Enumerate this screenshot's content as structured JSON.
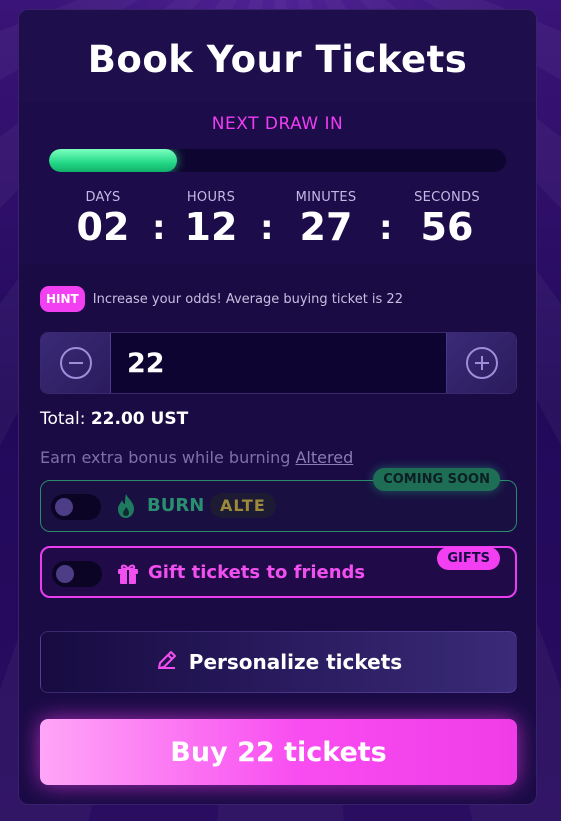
{
  "header": {
    "title": "Book Your Tickets"
  },
  "countdown": {
    "label": "NEXT DRAW IN",
    "progress": 0.28,
    "units": [
      {
        "label": "DAYS",
        "value": "02"
      },
      {
        "label": "HOURS",
        "value": "12"
      },
      {
        "label": "MINUTES",
        "value": "27"
      },
      {
        "label": "SECONDS",
        "value": "56"
      }
    ],
    "separator": ":"
  },
  "hint": {
    "badge": "HINT",
    "text": "Increase your odds! Average buying ticket is 22"
  },
  "quantity": {
    "value": "22"
  },
  "total": {
    "label": "Total:",
    "value": "22.00 UST"
  },
  "bonus": {
    "text": "Earn extra bonus while burning",
    "link": "Altered"
  },
  "burn_option": {
    "label": "BURN",
    "token": "ALTE",
    "tag": "COMING SOON",
    "enabled": false
  },
  "gift_option": {
    "label": "Gift tickets to friends",
    "tag": "GIFTS",
    "enabled": false
  },
  "personalize": {
    "label": "Personalize tickets"
  },
  "buy": {
    "label": "Buy 22 tickets"
  },
  "colors": {
    "accent_pink": "#f23ff1",
    "progress_green": "#23d886",
    "burn_green": "#2a8f6f",
    "card_bg": "#1a0b45"
  }
}
